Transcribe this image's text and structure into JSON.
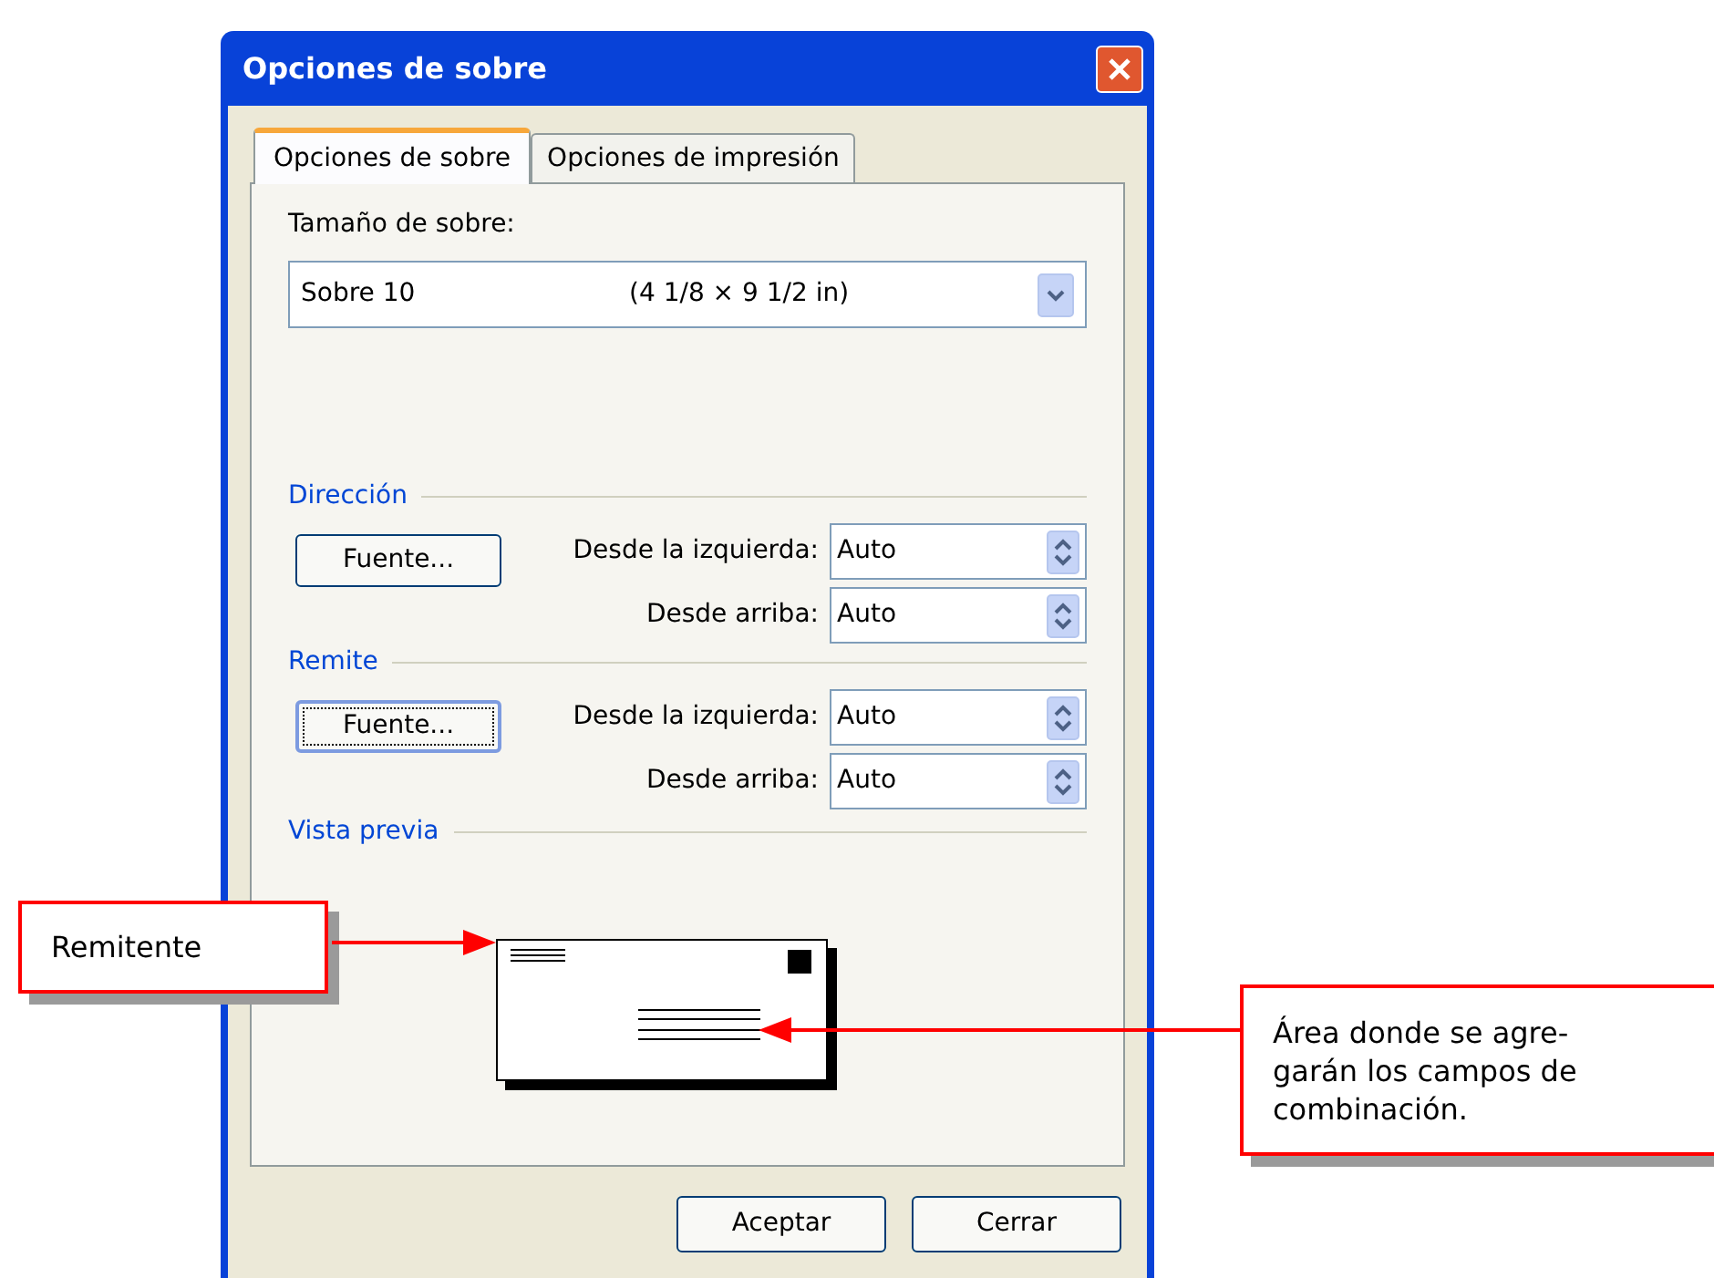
{
  "window": {
    "title": "Opciones de sobre"
  },
  "tabs": [
    {
      "label": "Opciones de sobre",
      "selected": true
    },
    {
      "label": "Opciones de impresión",
      "selected": false
    }
  ],
  "envelope_size": {
    "label": "Tamaño de sobre:",
    "value": "Sobre 10",
    "dimensions": "(4 1/8 × 9 1/2 in)"
  },
  "sections": [
    {
      "title": "Dirección",
      "button": {
        "label": "Fuente...",
        "focused": false
      },
      "fields": [
        {
          "label": "Desde la izquierda:",
          "value": "Auto"
        },
        {
          "label": "Desde arriba:",
          "value": "Auto"
        }
      ]
    },
    {
      "title": "Remite",
      "button": {
        "label": "Fuente...",
        "focused": true
      },
      "fields": [
        {
          "label": "Desde la izquierda:",
          "value": "Auto"
        },
        {
          "label": "Desde arriba:",
          "value": "Auto"
        }
      ]
    }
  ],
  "preview": {
    "title": "Vista previa"
  },
  "buttons": [
    "Aceptar",
    "Cerrar"
  ],
  "callouts": [
    {
      "kind": "left",
      "lines": [
        "Remitente"
      ]
    },
    {
      "kind": "right",
      "lines": [
        "Área donde se agre-",
        "garán los campos de",
        "combinación."
      ]
    }
  ]
}
